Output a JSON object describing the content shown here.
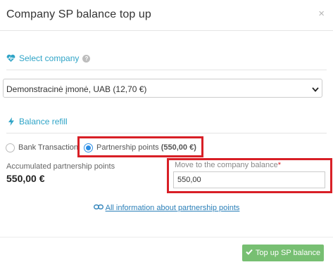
{
  "header": {
    "title": "Company SP balance top up",
    "close_glyph": "×"
  },
  "select_company": {
    "label": "Select company",
    "help": "?",
    "selected_value": "Demonstracinė įmonė, UAB (12,70 €)"
  },
  "balance_refill": {
    "label": "Balance refill",
    "options": [
      {
        "label": "Bank Transaction",
        "checked": false
      },
      {
        "label": "Partnership points",
        "amount": "(550,00 €)",
        "checked": true
      }
    ]
  },
  "accumulated": {
    "label": "Accumulated partnership points",
    "value": "550,00 €"
  },
  "move": {
    "label": "Move to the company balance",
    "required_mark": "*",
    "value": "550,00"
  },
  "info_link": {
    "text": "All information about partnership points"
  },
  "footer": {
    "button_label": "Top up SP balance"
  },
  "colors": {
    "accent": "#2fa4c7",
    "highlight": "#d81f26",
    "button": "#77bf72",
    "radio": "#2b8ee6"
  },
  "icons": [
    "heartbeat-icon",
    "help-icon",
    "chevron-down-icon",
    "bolt-icon",
    "link-icon",
    "check-icon",
    "close-icon"
  ]
}
